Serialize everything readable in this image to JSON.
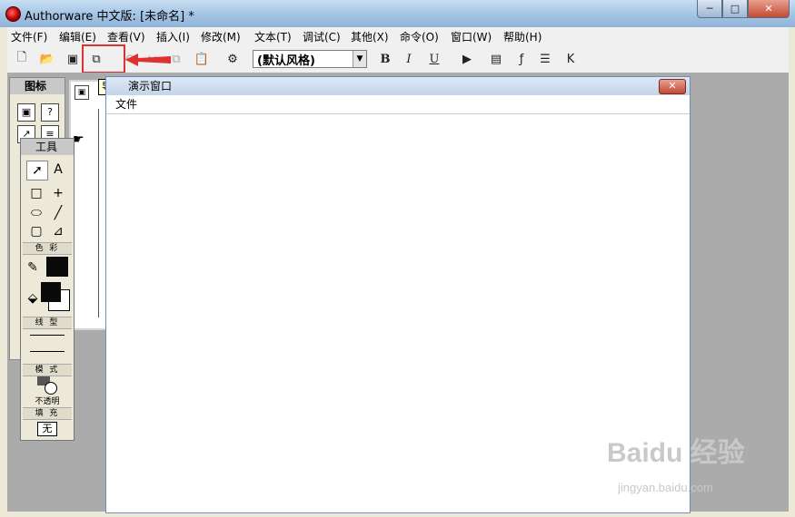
{
  "window": {
    "title": "Authorware 中文版: [未命名] *",
    "min": "─",
    "max": "□",
    "close": "✕"
  },
  "menu": [
    "文件(F)",
    "编辑(E)",
    "查看(V)",
    "插入(I)",
    "修改(M)",
    "文本(T)",
    "调试(C)",
    "其他(X)",
    "命令(O)",
    "窗口(W)",
    "帮助(H)"
  ],
  "toolbar": {
    "style_value": "(默认风格)",
    "bold": "B",
    "italic": "I",
    "underline": "U"
  },
  "tooltip": "导入",
  "icons_palette": {
    "title": "图标"
  },
  "tools_palette": {
    "title": "工具",
    "color_label": "色 彩",
    "line_label": "线 型",
    "mode_label": "模 式",
    "mode_value": "不透明",
    "fill_label": "填 充",
    "fill_value": "无"
  },
  "presentation": {
    "title": "演示窗口",
    "menu": "文件",
    "close": "✕"
  },
  "watermark": {
    "text": "Baidu 经验",
    "sub": "jingyan.baidu.com"
  },
  "colors": {
    "highlight": "#e03030",
    "titlebar": "#a9c8e6",
    "accent": "#c24a32"
  }
}
